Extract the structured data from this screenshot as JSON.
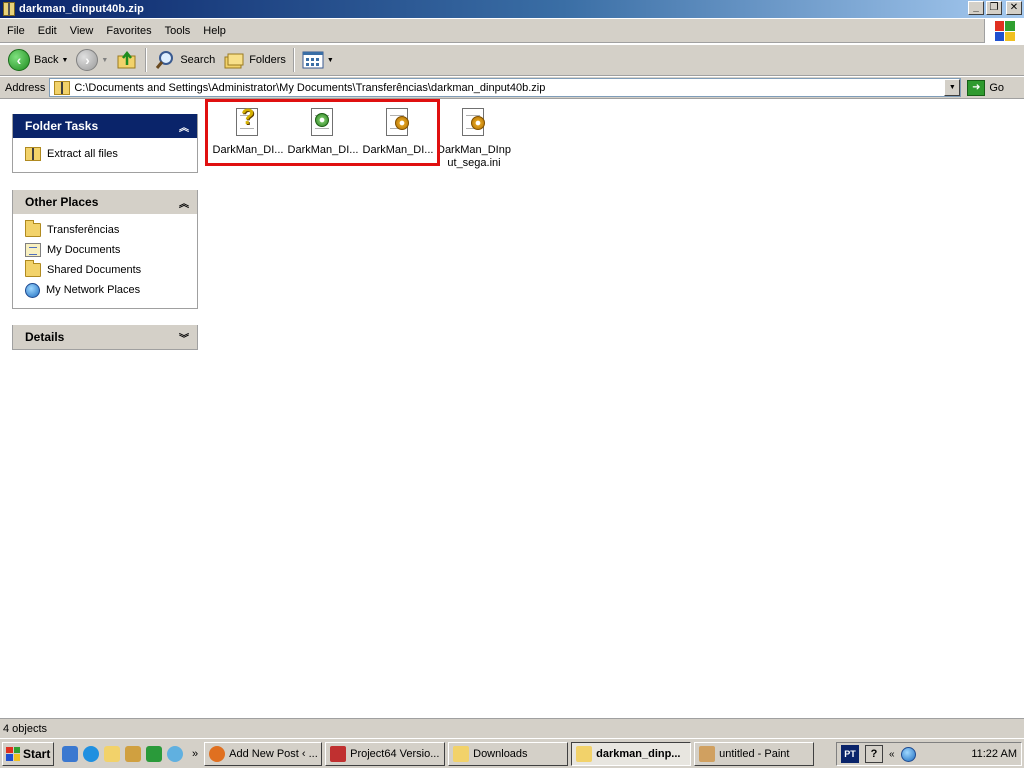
{
  "window": {
    "title": "darkman_dinput40b.zip",
    "minimize": "_",
    "restore": "❐",
    "close": "✕"
  },
  "menu": [
    "File",
    "Edit",
    "View",
    "Favorites",
    "Tools",
    "Help"
  ],
  "toolbar": {
    "back": "Back",
    "search": "Search",
    "folders": "Folders"
  },
  "address": {
    "label": "Address",
    "path": "C:\\Documents and Settings\\Administrator\\My Documents\\Transferências\\darkman_dinput40b.zip",
    "go": "Go"
  },
  "left_panel": {
    "folder_tasks": {
      "title": "Folder Tasks",
      "items": [
        "Extract all files"
      ]
    },
    "other_places": {
      "title": "Other Places",
      "items": [
        "Transferências",
        "My Documents",
        "Shared Documents",
        "My Network Places"
      ]
    },
    "details": {
      "title": "Details"
    }
  },
  "files": [
    {
      "name": "DarkMan_DI...",
      "icon": "help-file-icon"
    },
    {
      "name": "DarkMan_DI...",
      "icon": "dll-file-icon"
    },
    {
      "name": "DarkMan_DI...",
      "icon": "config-file-icon"
    },
    {
      "name": "DarkMan_DInput_sega.ini",
      "icon": "ini-file-icon"
    }
  ],
  "status": {
    "text": "4 objects"
  },
  "taskbar": {
    "start": "Start",
    "more": "»",
    "buttons": [
      {
        "label": "Add New Post ‹ ...",
        "active": false
      },
      {
        "label": "Project64 Versio...",
        "active": false
      },
      {
        "label": "Downloads",
        "active": false
      },
      {
        "label": "darkman_dinp...",
        "active": true
      },
      {
        "label": "untitled - Paint",
        "active": false
      }
    ],
    "tray": {
      "lang": "PT",
      "help": "?",
      "arrows": "«",
      "clock": "11:22 AM"
    }
  },
  "colors": {
    "title_bar": "#0a246a",
    "highlight_box": "#e01010",
    "chrome": "#d4d0c8"
  }
}
